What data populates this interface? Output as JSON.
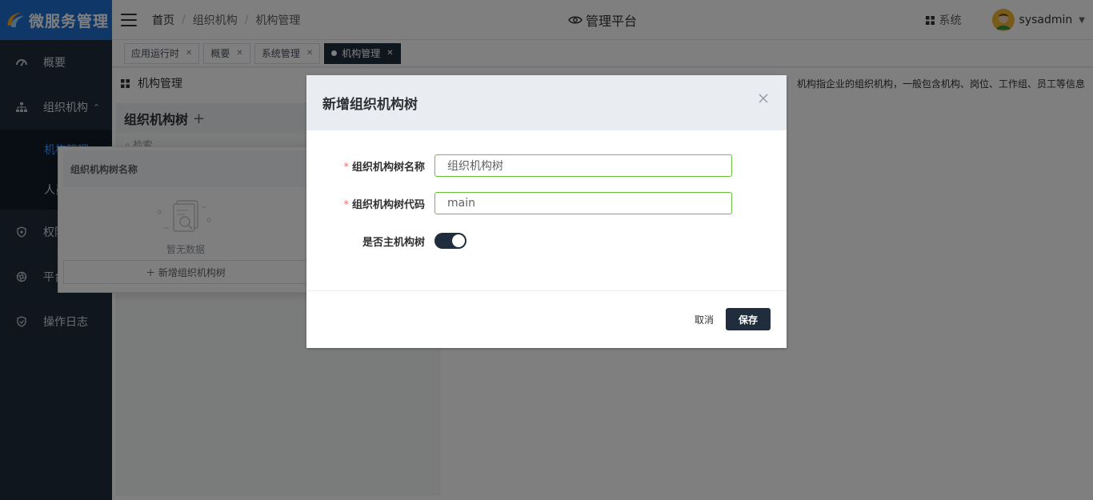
{
  "brand": {
    "title": "微服务管理"
  },
  "sidebar": {
    "items": [
      {
        "label": "概要",
        "icon": "dashboard-icon"
      },
      {
        "label": "组织机构",
        "icon": "org-tree-icon",
        "expanded": true,
        "children": [
          {
            "label": "机构管理",
            "active": true
          },
          {
            "label": "人员管理"
          }
        ]
      },
      {
        "label": "权限管理",
        "icon": "shield-icon"
      },
      {
        "label": "平台管理",
        "icon": "aperture-icon"
      },
      {
        "label": "操作日志",
        "icon": "shield-lock-icon"
      }
    ]
  },
  "header": {
    "breadcrumb": [
      "首页",
      "组织机构",
      "机构管理"
    ],
    "center_title": "管理平台",
    "system_label": "系统",
    "username": "sysadmin"
  },
  "tabs": [
    {
      "label": "应用运行时"
    },
    {
      "label": "概要"
    },
    {
      "label": "系统管理"
    },
    {
      "label": "机构管理",
      "active": true
    }
  ],
  "page": {
    "title": "机构管理",
    "description": "机构指企业的组织机构，一般包含机构、岗位、工作组、员工等信息"
  },
  "tree_panel": {
    "title": "组织机构树",
    "search_placeholder": "检索"
  },
  "dropdown": {
    "column_header": "组织机构树名称",
    "empty_text": "暂无数据",
    "add_label": "＋ 新增组织机构树"
  },
  "dialog": {
    "title": "新增组织机构树",
    "fields": {
      "name": {
        "label": "组织机构树名称",
        "value": "组织机构树"
      },
      "code": {
        "label": "组织机构树代码",
        "value": "main"
      },
      "is_main": {
        "label": "是否主机构树",
        "checked": true
      }
    },
    "cancel_label": "取消",
    "save_label": "保存"
  },
  "colors": {
    "sidebar_bg": "#1f2d3d",
    "logo_bg": "#1e6fd0",
    "accent": "#1f2d3d",
    "valid_border": "#67c23a",
    "required": "#f56c6c"
  }
}
